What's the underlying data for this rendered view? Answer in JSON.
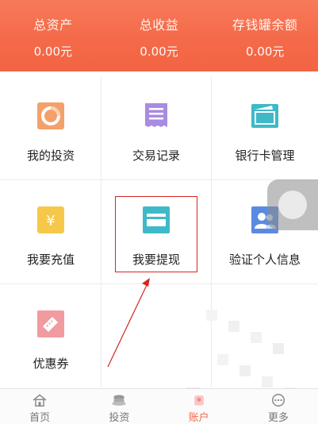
{
  "summary": {
    "items": [
      {
        "label": "总资产",
        "value": "0.00元"
      },
      {
        "label": "总收益",
        "value": "0.00元"
      },
      {
        "label": "存钱罐余额",
        "value": "0.00元"
      }
    ]
  },
  "grid": {
    "items": [
      {
        "label": "我的投资",
        "icon": "pie-chart-icon",
        "color": "#f4a06a"
      },
      {
        "label": "交易记录",
        "icon": "receipt-icon",
        "color": "#a98be0"
      },
      {
        "label": "银行卡管理",
        "icon": "wallet-icon",
        "color": "#3fb9c8"
      },
      {
        "label": "我要充值",
        "icon": "yen-icon",
        "color": "#f6c84a"
      },
      {
        "label": "我要提现",
        "icon": "card-icon",
        "color": "#3fb9c8"
      },
      {
        "label": "验证个人信息",
        "icon": "id-user-icon",
        "color": "#5b8be0"
      },
      {
        "label": "优惠券",
        "icon": "coupon-icon",
        "color": "#f19ba0"
      }
    ]
  },
  "tabbar": {
    "items": [
      {
        "label": "首页",
        "icon": "home-icon"
      },
      {
        "label": "投资",
        "icon": "coins-icon"
      },
      {
        "label": "账户",
        "icon": "account-icon"
      },
      {
        "label": "更多",
        "icon": "more-icon"
      }
    ],
    "active_index": 2,
    "active_color": "#f46a49"
  },
  "colors": {
    "header_bg": "#f46a49",
    "highlight": "#d62424"
  }
}
